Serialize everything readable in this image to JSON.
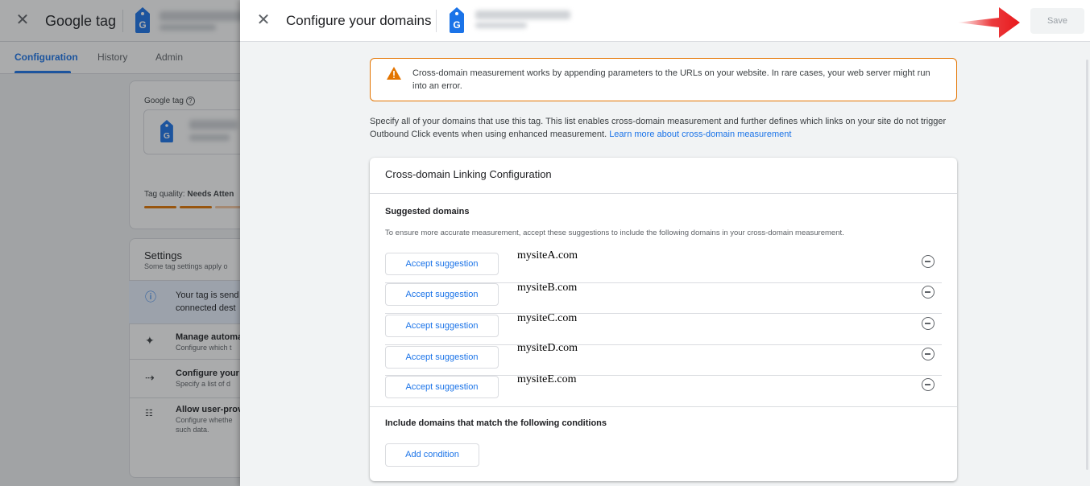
{
  "background_page": {
    "app_title": "Google tag",
    "tabs": [
      {
        "label": "Configuration",
        "active": true
      },
      {
        "label": "History",
        "active": false
      },
      {
        "label": "Admin",
        "active": false
      }
    ],
    "tag_label": "Google tag",
    "tag_quality_label": "Tag quality:",
    "tag_quality_value": "Needs Atten",
    "settings": {
      "title": "Settings",
      "subtitle": "Some tag settings apply o",
      "rows": [
        {
          "icon": "info-icon",
          "title": "Your tag is send",
          "subtitle": "connected dest"
        },
        {
          "icon": "sparkle-icon",
          "title": "Manage automa",
          "subtitle": "Configure which t"
        },
        {
          "icon": "merge-icon",
          "title": "Configure your",
          "subtitle": "Specify a list of d"
        },
        {
          "icon": "user-data-icon",
          "title": "Allow user-prov",
          "subtitle": "Configure whethe",
          "subtitle2": "such data."
        }
      ]
    }
  },
  "panel": {
    "title": "Configure your domains",
    "save_label": "Save",
    "warning_text": "Cross-domain measurement works by appending parameters to the URLs on your website. In rare cases, your web server might run into an error.",
    "intro_text": "Specify all of your domains that use this tag. This list enables cross-domain measurement and further defines which links on your site do not trigger Outbound Click events when using enhanced measurement.",
    "learn_more_link": "Learn more about cross-domain measurement",
    "card": {
      "title": "Cross-domain Linking Configuration",
      "suggested_title": "Suggested domains",
      "suggested_desc": "To ensure more accurate measurement, accept these suggestions to include the following domains in your cross-domain measurement.",
      "suggestions": [
        {
          "button": "Accept suggestion",
          "domain": "mysiteA.com"
        },
        {
          "button": "Accept suggestion",
          "domain": "mysiteB.com"
        },
        {
          "button": "Accept suggestion",
          "domain": "mysiteC.com"
        },
        {
          "button": "Accept suggestion",
          "domain": "mysiteD.com"
        },
        {
          "button": "Accept suggestion",
          "domain": "mysiteE.com"
        }
      ],
      "conditions_title": "Include domains that match the following conditions",
      "add_condition_label": "Add condition"
    }
  },
  "colors": {
    "accent": "#1a73e8",
    "warning": "#e37400",
    "tag_logo": "#1a73e8",
    "annotation_arrow": "#e8191c"
  }
}
